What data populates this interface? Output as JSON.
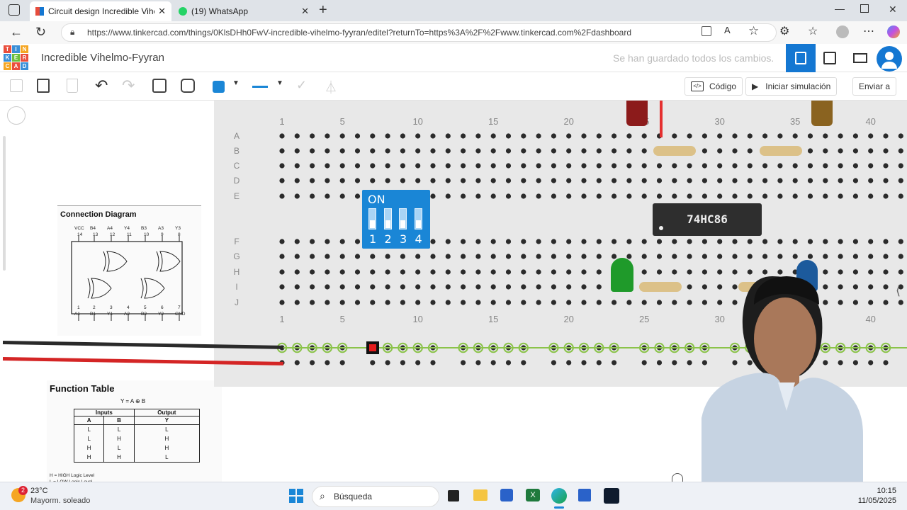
{
  "browser": {
    "tabs": [
      {
        "title": "Circuit design Incredible Vihelmo",
        "active": true
      },
      {
        "title": "(19) WhatsApp",
        "active": false
      }
    ],
    "url": "https://www.tinkercad.com/things/0KlsDHh0FwV-incredible-vihelmo-fyyran/editel?returnTo=https%3A%2F%2Fwww.tinkercad.com%2Fdashboard"
  },
  "app": {
    "logo_letters": [
      "T",
      "I",
      "N",
      "K",
      "E",
      "R",
      "C",
      "A",
      "D"
    ],
    "title": "Incredible Vihelmo-Fyyran",
    "save_status": "Se han guardado todos los cambios."
  },
  "toolbar": {
    "code_label": "Código",
    "simulate_label": "Iniciar simulación",
    "send_label": "Enviar a"
  },
  "breadboard": {
    "column_numbers": [
      "1",
      "5",
      "10",
      "15",
      "20",
      "25",
      "30",
      "35",
      "40"
    ],
    "rows_top": [
      "A",
      "B",
      "C",
      "D",
      "E"
    ],
    "rows_bottom": [
      "F",
      "G",
      "H",
      "I",
      "J"
    ],
    "dip_switch": {
      "label": "ON",
      "numbers": [
        "1",
        "2",
        "3",
        "4"
      ]
    },
    "chip_label": "74HC86"
  },
  "connection_diagram": {
    "title": "Connection Diagram",
    "top_pins": [
      "VCC",
      "B4",
      "A4",
      "Y4",
      "B3",
      "A3",
      "Y3"
    ],
    "top_nums": [
      "14",
      "13",
      "12",
      "11",
      "10",
      "9",
      "8"
    ],
    "bottom_pins": [
      "A1",
      "B1",
      "Y1",
      "A2",
      "B2",
      "Y2",
      "GND"
    ],
    "bottom_nums": [
      "1",
      "2",
      "3",
      "4",
      "5",
      "6",
      "7"
    ]
  },
  "function_table": {
    "title": "Function Table",
    "equation": "Y = A ⊕ B",
    "group_headers": [
      "Inputs",
      "Output"
    ],
    "headers": [
      "A",
      "B",
      "Y"
    ],
    "rows": [
      [
        "L",
        "L",
        "L"
      ],
      [
        "L",
        "H",
        "H"
      ],
      [
        "H",
        "L",
        "H"
      ],
      [
        "H",
        "H",
        "L"
      ]
    ],
    "notes": [
      "H = HIGH Logic Level",
      "L = LOW Logic Level"
    ]
  },
  "taskbar": {
    "weather_temp": "23°C",
    "weather_desc": "Mayorm. soleado",
    "weather_badge": "2",
    "search_placeholder": "Búsqueda",
    "time": "10:15",
    "date": "11/05/2025"
  },
  "colors": {
    "accent": "#1477d2",
    "board": "#e8e8e8",
    "chip": "#2e2e2e",
    "dip": "#1a86d6"
  }
}
